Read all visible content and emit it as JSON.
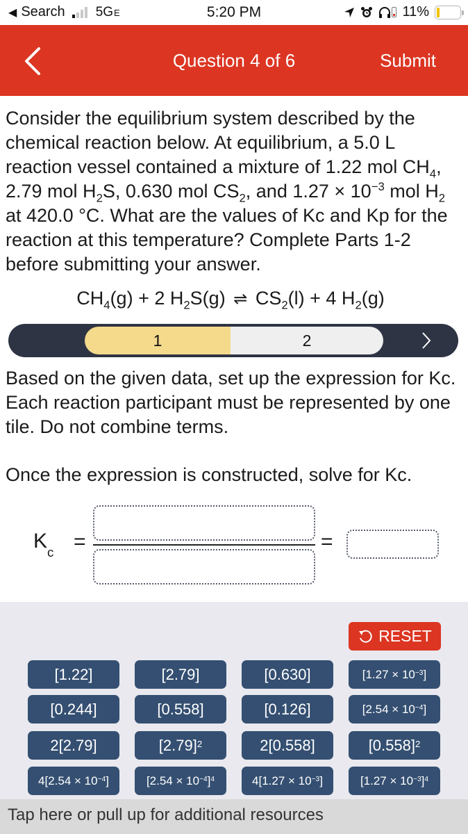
{
  "status_bar": {
    "back_app_label": "Search",
    "network": "5G",
    "network_suffix": "E",
    "time": "5:20 PM",
    "battery_percent": "11%",
    "battery_level": 0.11
  },
  "header": {
    "title": "Question 4 of 6",
    "submit_label": "Submit",
    "background_color": "#dc3522"
  },
  "question": {
    "text_line1": "Consider the equilibrium system described by the chemical reaction below. At equilibrium, a 5.0 L reaction vessel contained a mixture of 1.22 mol CH",
    "sub_ch4": "4",
    "text_line2": ", 2.79 mol H",
    "sub_h2s": "2",
    "text_line3": "S, 0.630 mol CS",
    "sub_cs2": "2",
    "text_line4": ", and 1.27 × 10",
    "sup_exp": "−3",
    "text_line5": " mol H",
    "sub_h2": "2",
    "text_line6": " at 420.0 °C. What are the values of Kc and Kp for the reaction at this temperature? Complete Parts 1-2 before submitting your answer."
  },
  "equation": {
    "r1": "CH",
    "r1_sub": "4",
    "r1_state": "(g) + 2 H",
    "r2_sub": "2",
    "r2_state": "S(g)",
    "arrow": "⇌",
    "p1": "CS",
    "p1_sub": "2",
    "p1_state": "(l) + 4 H",
    "p2_sub": "2",
    "p2_state": "(g)"
  },
  "parts": {
    "tabs": [
      {
        "label": "1",
        "active": true
      },
      {
        "label": "2",
        "active": false
      }
    ],
    "active_color": "#f5da8c"
  },
  "instructions": {
    "p1": "Based on the given data, set up the expression for Kc. Each reaction participant must be represented by one tile. Do not combine terms.",
    "p2": "Once the expression is constructed, solve for Kc."
  },
  "expression": {
    "k_label": "K",
    "k_sub": "c",
    "equals": "=",
    "numerator": "",
    "denominator": "",
    "result": ""
  },
  "reset_label": "RESET",
  "tiles": [
    {
      "base": "[1.22]",
      "sup": ""
    },
    {
      "base": "[2.79]",
      "sup": ""
    },
    {
      "base": "[0.630]",
      "sup": ""
    },
    {
      "base": "[1.27 × 10",
      "exp": "−3",
      "close": "]",
      "sup": ""
    },
    {
      "base": "[0.244]",
      "sup": ""
    },
    {
      "base": "[0.558]",
      "sup": ""
    },
    {
      "base": "[0.126]",
      "sup": ""
    },
    {
      "base": "[2.54 × 10",
      "exp": "−4",
      "close": "]",
      "sup": ""
    },
    {
      "base": "2[2.79]",
      "sup": ""
    },
    {
      "base": "[2.79]",
      "sup": "2"
    },
    {
      "base": "2[0.558]",
      "sup": ""
    },
    {
      "base": "[0.558]",
      "sup": "2"
    },
    {
      "base": "4[2.54 × 10",
      "exp": "−4",
      "close": "]",
      "sup": ""
    },
    {
      "base": "[2.54 × 10",
      "exp": "−4",
      "close": "]",
      "sup": "4"
    },
    {
      "base": "4[1.27 × 10",
      "exp": "−3",
      "close": "]",
      "sup": ""
    },
    {
      "base": "[1.27 × 10",
      "exp": "−3",
      "close": "]",
      "sup": "4"
    }
  ],
  "tile_color": "#344f71",
  "resources_label": "Tap here or pull up for additional resources"
}
